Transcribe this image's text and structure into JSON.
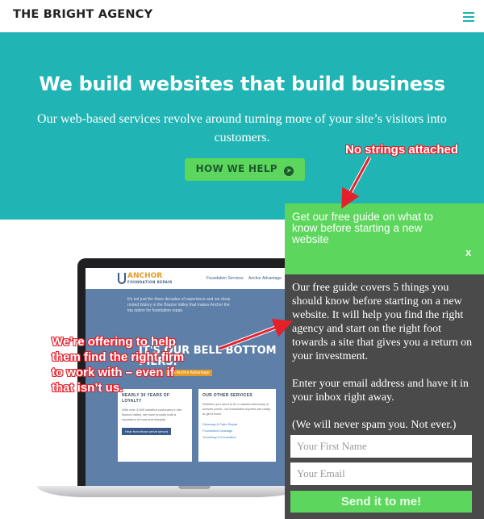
{
  "header": {
    "brand": "THE BRIGHT AGENCY",
    "menu_icon": "hamburger-menu-icon"
  },
  "hero": {
    "title": "We build websites that build business",
    "subtitle": "Our web-based services revolve around turning more of your site’s visitors into customers.",
    "button_label": "HOW WE HELP",
    "button_icon": "arrow-right-circle-icon"
  },
  "laptop_screen": {
    "logo_main": "ANCHOR",
    "logo_sub": "FOUNDATION REPAIR",
    "nav_items": [
      "Foundation Services",
      "Anchor Advantage"
    ],
    "blurb": "It's not just the three decades of experience and our deep rooted history in the Brazos Valley that makes Anchor the top option for foundation repair.",
    "headline": "IT'S OUR BELL BOTTOM PIERS.",
    "advantage_tag": "The Anchor Advantage",
    "card_left": {
      "title": "NEARLY 30 YEARS OF LOYALTY",
      "text": "With over 3,500 satisfied customers in the Brazos Valley, we have proudly built a reputation of trust and integrity.",
      "button": "Hear from those we've served"
    },
    "card_right": {
      "title": "OUR OTHER SERVICES",
      "text": "Whether you need to fix a cracked driveway or uneven porch, our foundation experts are ready to get it fixed.",
      "links": [
        "Driveway & Patio Repair",
        "Foundation Drainage",
        "Tunneling & Excavation"
      ]
    }
  },
  "popup": {
    "title": "Get our free guide on what to know before starting a new website",
    "close_label": "x",
    "body": [
      "Our free guide covers 5 things you should know before starting on a new website. It will help you find the right agency and start on the right foot towards a site that gives you a return on your investment.",
      "Enter your email address and have it in your inbox right away.",
      "(We will never spam you. Not ever.)"
    ],
    "first_name_placeholder": "Your First Name",
    "email_placeholder": "Your Email",
    "submit_label": "Send it to me!"
  },
  "annotations": {
    "top": "No strings attached",
    "left": [
      "We’re offering to help",
      "them find the right firm",
      "to work with – even if",
      "that isn’t us."
    ]
  },
  "colors": {
    "hero_bg": "#20b5b4",
    "accent_green": "#5cd65c",
    "popup_bg": "#4a4a4a",
    "annotation_red": "#e4202a"
  }
}
